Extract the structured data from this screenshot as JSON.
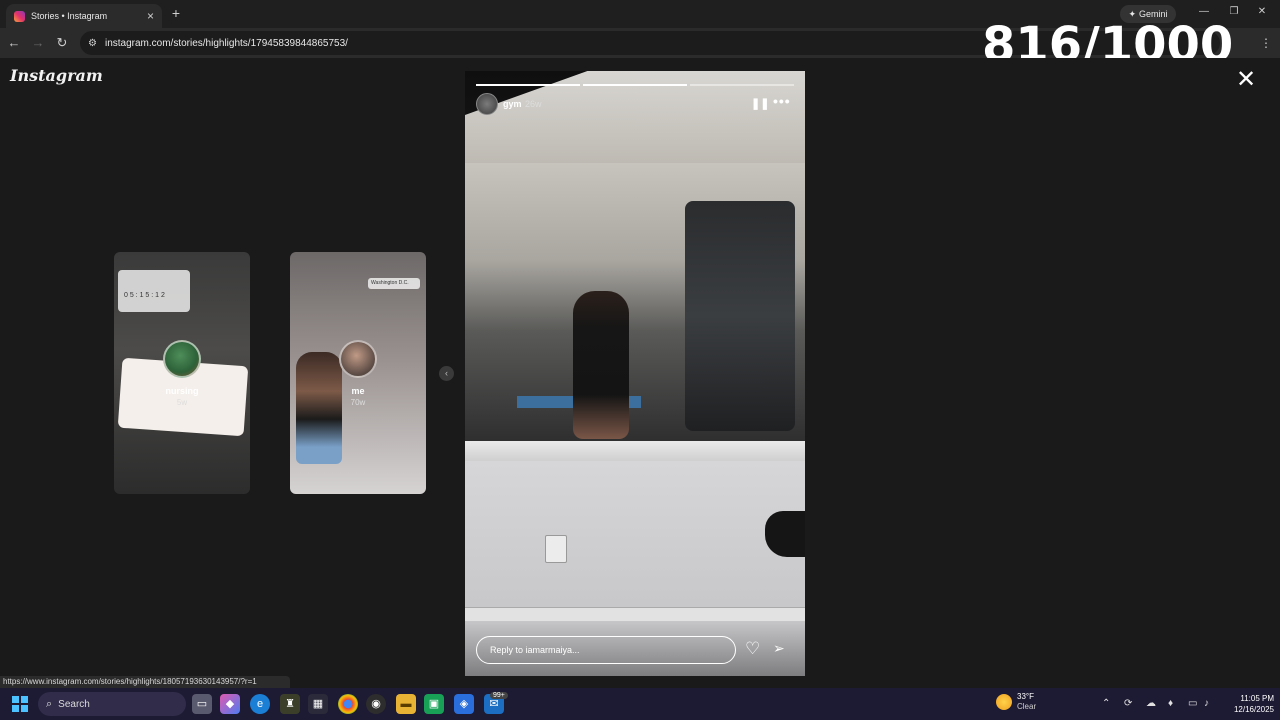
{
  "browser": {
    "tab_title": "Stories • Instagram",
    "tab_close": "×",
    "new_tab": "+",
    "gemini_label": "Gemini",
    "url": "instagram.com/stories/highlights/17945839844865753/",
    "status_url": "https://www.instagram.com/stories/highlights/18057193630143957/?r=1"
  },
  "overlay_counter": "816/1000",
  "page": {
    "logo": "Instagram",
    "close_glyph": "✕"
  },
  "highlights": [
    {
      "label": "nursing",
      "age": "5w",
      "timer": "0 5 : 1 5 : 1 2"
    },
    {
      "label": "me",
      "age": "70w",
      "location": "Washington D.C."
    }
  ],
  "story": {
    "username": "gym",
    "age": "26w",
    "reply_placeholder": "Reply to iamarmaiya...",
    "progress": [
      1.0,
      1.0,
      0.0
    ]
  },
  "taskbar": {
    "search_label": "Search",
    "weather_temp": "33°F",
    "weather_condition": "Clear",
    "time": "11:05 PM",
    "date": "12/16/2025",
    "badge": "99+"
  },
  "colors": {
    "accent_blue": "#4cc2ff",
    "taskbar_bg": "#1d1a33",
    "page_bg": "#1a1a1a"
  }
}
